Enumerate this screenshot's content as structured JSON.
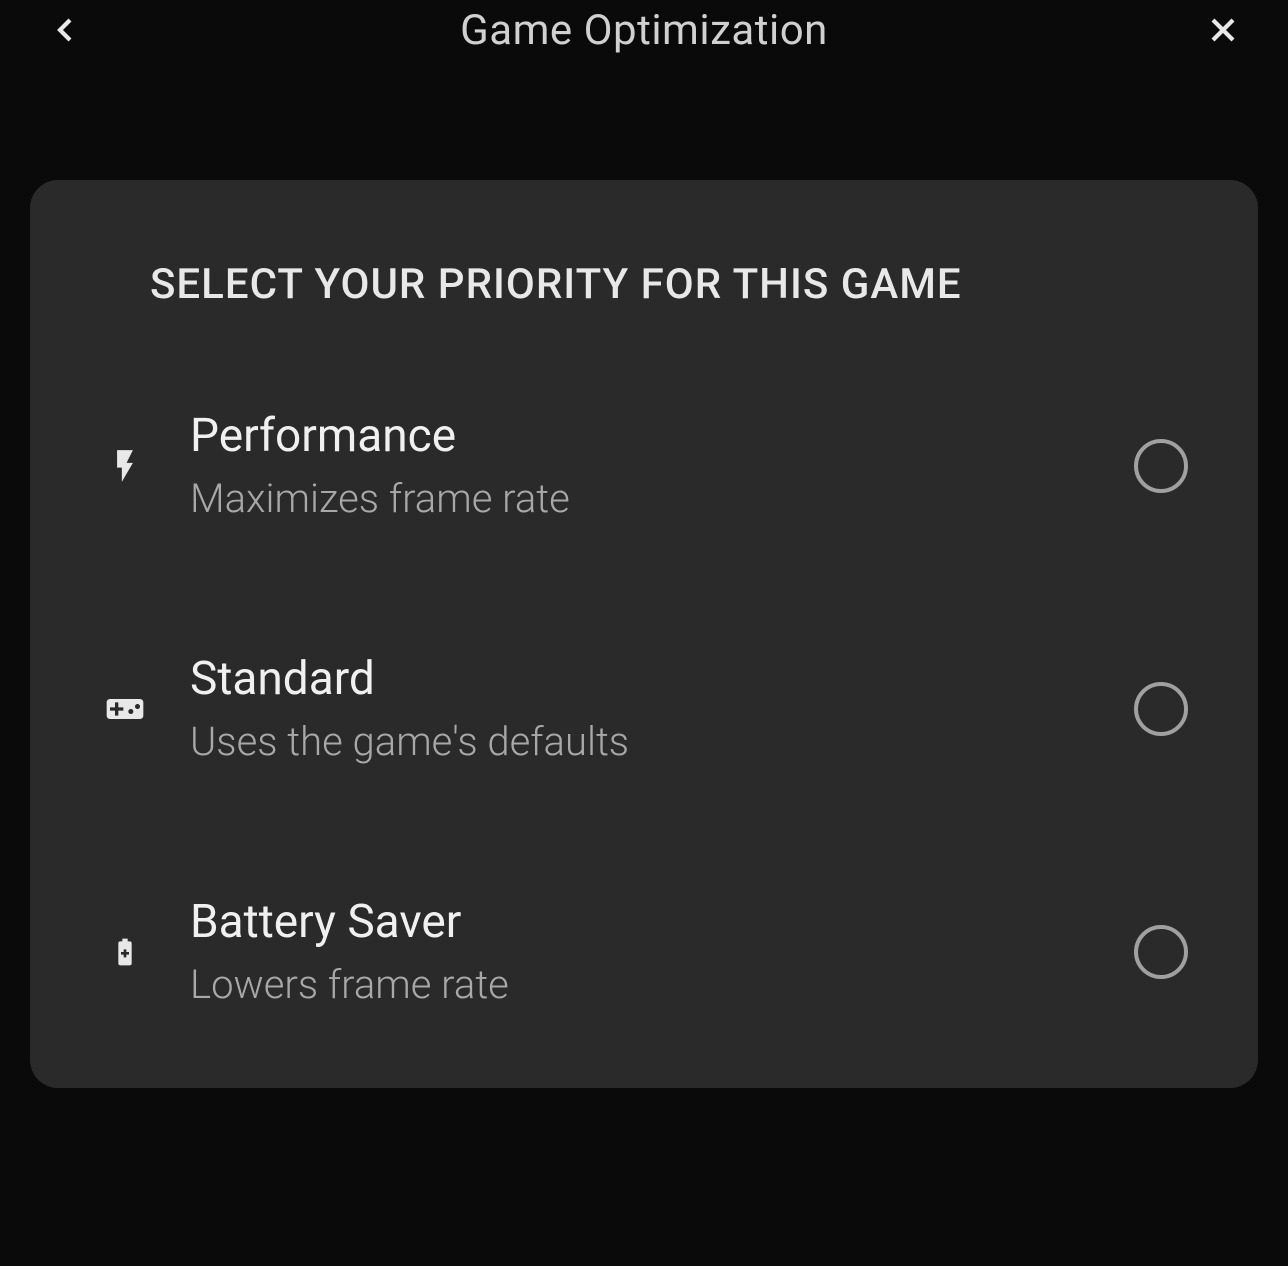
{
  "header": {
    "title": "Game Optimization"
  },
  "card": {
    "heading": "SELECT YOUR PRIORITY FOR THIS GAME",
    "options": [
      {
        "title": "Performance",
        "description": "Maximizes frame rate",
        "icon": "bolt"
      },
      {
        "title": "Standard",
        "description": "Uses the game's defaults",
        "icon": "gamepad"
      },
      {
        "title": "Battery Saver",
        "description": "Lowers frame rate",
        "icon": "battery"
      }
    ]
  }
}
